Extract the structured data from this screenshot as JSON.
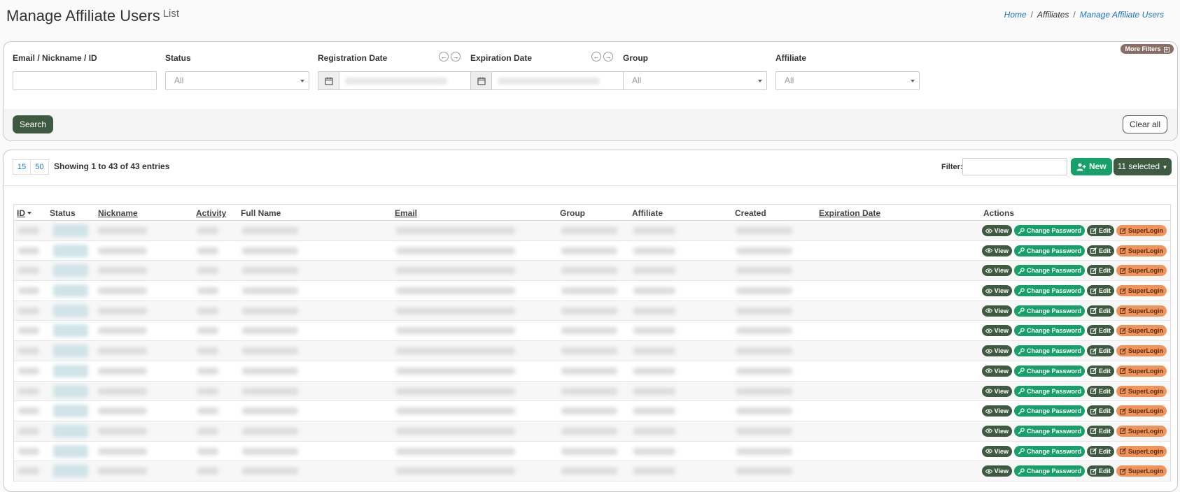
{
  "header": {
    "title": "Manage Affiliate Users",
    "subtitle": "List"
  },
  "breadcrumb": {
    "home": "Home",
    "sep1": "/",
    "section": "Affiliates",
    "sep2": "/",
    "current": "Manage Affiliate Users"
  },
  "filters": {
    "more_filters": "More Filters",
    "email_label": "Email / Nickname / ID",
    "status_label": "Status",
    "status_value": "All",
    "registration_label": "Registration Date",
    "expiration_label": "Expiration Date",
    "group_label": "Group",
    "group_value": "All",
    "affiliate_label": "Affiliate",
    "affiliate_value": "All",
    "search_button": "Search",
    "clear_button": "Clear all"
  },
  "list": {
    "page_sizes": [
      "15",
      "50"
    ],
    "entries_text": "Showing 1 to 43 of 43 entries",
    "filter_label": "Filter:",
    "new_button": "New",
    "selected_button": "11 selected"
  },
  "table": {
    "columns": {
      "id": "ID",
      "status": "Status",
      "nickname": "Nickname",
      "activity": "Activity",
      "full_name": "Full Name",
      "email": "Email",
      "group": "Group",
      "affiliate": "Affiliate",
      "created": "Created",
      "expiration": "Expiration Date",
      "actions": "Actions"
    },
    "actions": {
      "view": "View",
      "change_password": "Change Password",
      "edit": "Edit",
      "superlogin": "SuperLogin"
    }
  },
  "colors": {
    "dark_green": "#3e5a40",
    "green": "#17a06a",
    "orange": "#f0945c",
    "link_blue": "#1a73c8"
  }
}
